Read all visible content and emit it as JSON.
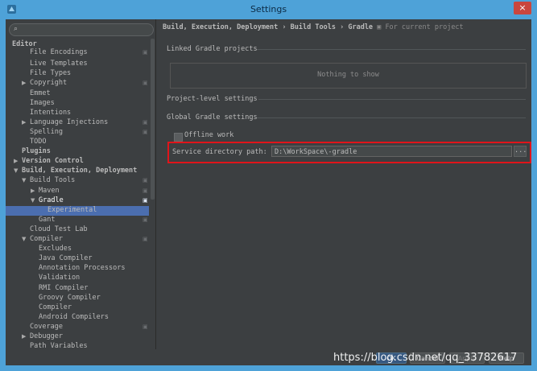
{
  "window": {
    "title": "Settings",
    "close_label": "×"
  },
  "search": {
    "placeholder": ""
  },
  "tree": [
    {
      "label": "Editor",
      "bold": true,
      "indent": 0,
      "arrow": ""
    },
    {
      "label": "File Encodings",
      "indent": 2,
      "arrow": "",
      "proj": true
    },
    {
      "label": "Live Templates",
      "indent": 2,
      "arrow": ""
    },
    {
      "label": "File Types",
      "indent": 2,
      "arrow": ""
    },
    {
      "label": "Copyright",
      "indent": 2,
      "arrow": "right",
      "proj": true
    },
    {
      "label": "Emmet",
      "indent": 2,
      "arrow": ""
    },
    {
      "label": "Images",
      "indent": 2,
      "arrow": ""
    },
    {
      "label": "Intentions",
      "indent": 2,
      "arrow": ""
    },
    {
      "label": "Language Injections",
      "indent": 2,
      "arrow": "right",
      "proj": true
    },
    {
      "label": "Spelling",
      "indent": 2,
      "arrow": "",
      "proj": true
    },
    {
      "label": "TODO",
      "indent": 2,
      "arrow": ""
    },
    {
      "label": "Plugins",
      "bold": true,
      "indent": 1,
      "arrow": ""
    },
    {
      "label": "Version Control",
      "bold": true,
      "indent": 1,
      "arrow": "right"
    },
    {
      "label": "Build, Execution, Deployment",
      "bold": true,
      "indent": 1,
      "arrow": "down"
    },
    {
      "label": "Build Tools",
      "indent": 2,
      "arrow": "down",
      "proj": true
    },
    {
      "label": "Maven",
      "indent": 3,
      "arrow": "right",
      "proj": true
    },
    {
      "label": "Gradle",
      "indent": 3,
      "arrow": "down",
      "proj": true,
      "selected": true
    },
    {
      "label": "Experimental",
      "indent": 4,
      "arrow": ""
    },
    {
      "label": "Gant",
      "indent": 3,
      "arrow": "",
      "proj": true
    },
    {
      "label": "Cloud Test Lab",
      "indent": 2,
      "arrow": ""
    },
    {
      "label": "Compiler",
      "indent": 2,
      "arrow": "down",
      "proj": true
    },
    {
      "label": "Excludes",
      "indent": 3,
      "arrow": ""
    },
    {
      "label": "Java Compiler",
      "indent": 3,
      "arrow": ""
    },
    {
      "label": "Annotation Processors",
      "indent": 3,
      "arrow": ""
    },
    {
      "label": "Validation",
      "indent": 3,
      "arrow": ""
    },
    {
      "label": "RMI Compiler",
      "indent": 3,
      "arrow": ""
    },
    {
      "label": "Groovy Compiler",
      "indent": 3,
      "arrow": ""
    },
    {
      "label": "Compiler",
      "indent": 3,
      "arrow": ""
    },
    {
      "label": "Android Compilers",
      "indent": 3,
      "arrow": ""
    },
    {
      "label": "Coverage",
      "indent": 2,
      "arrow": "",
      "proj": true
    },
    {
      "label": "Debugger",
      "indent": 2,
      "arrow": "right"
    },
    {
      "label": "Path Variables",
      "indent": 2,
      "arrow": ""
    }
  ],
  "breadcrumb": {
    "part1": "Build, Execution, Deployment",
    "part2": "Build Tools",
    "part3": "Gradle",
    "note": "For current project"
  },
  "sections": {
    "linked": "Linked Gradle projects",
    "nothing": "Nothing to show",
    "project_level": "Project-level settings",
    "global": "Global Gradle settings"
  },
  "offline_work": {
    "label": "Offline work",
    "checked": false
  },
  "service_path": {
    "label": "Service directory path:",
    "value": "D:\\WorkSpace\\-gradle",
    "browse": "..."
  },
  "buttons": {
    "ok": "OK",
    "cancel": "Cancel",
    "apply": "Apply",
    "help": "Help"
  },
  "watermark": "https://blog.csdn.net/qq_33782617"
}
